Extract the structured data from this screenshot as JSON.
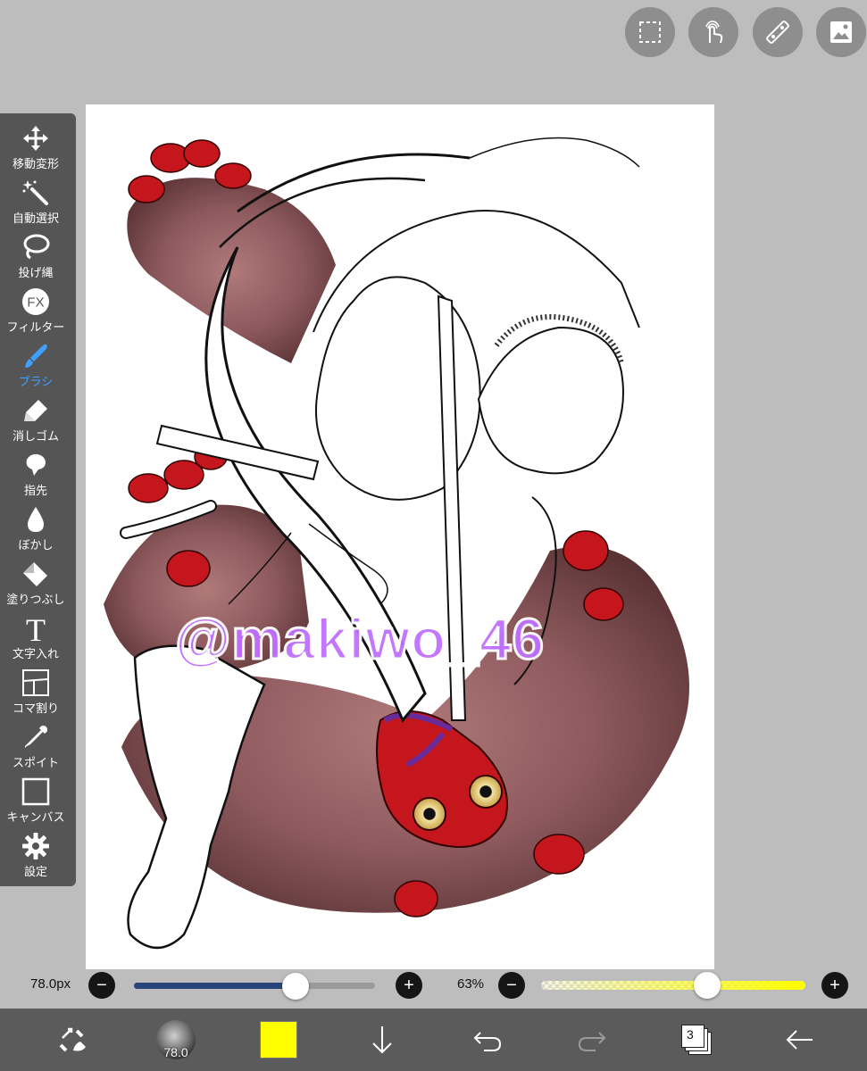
{
  "top_actions": [
    {
      "name": "selection-icon"
    },
    {
      "name": "gesture-icon"
    },
    {
      "name": "ruler-icon"
    },
    {
      "name": "image-icon"
    }
  ],
  "toolbar": {
    "items": [
      {
        "label": "移動変形",
        "icon": "move-transform-icon"
      },
      {
        "label": "自動選択",
        "icon": "magic-wand-icon"
      },
      {
        "label": "投げ縄",
        "icon": "lasso-icon"
      },
      {
        "label": "フィルター",
        "icon": "fx-icon",
        "icon_text": "FX"
      },
      {
        "label": "ブラシ",
        "icon": "brush-icon",
        "active": true
      },
      {
        "label": "消しゴム",
        "icon": "eraser-icon"
      },
      {
        "label": "指先",
        "icon": "finger-icon"
      },
      {
        "label": "ぼかし",
        "icon": "blur-drop-icon"
      },
      {
        "label": "塗りつぶし",
        "icon": "fill-bucket-icon"
      },
      {
        "label": "文字入れ",
        "icon": "text-icon",
        "icon_text": "T"
      },
      {
        "label": "コマ割り",
        "icon": "panel-split-icon"
      },
      {
        "label": "スポイト",
        "icon": "eyedropper-icon"
      },
      {
        "label": "キャンバス",
        "icon": "canvas-icon"
      },
      {
        "label": "設定",
        "icon": "gear-icon"
      }
    ],
    "active_color": "#3ea0ff"
  },
  "canvas": {
    "watermark": "@makiwo_46",
    "background": "#ffffff"
  },
  "brush_size": {
    "label": "78.0px",
    "value_fraction": 0.67,
    "minus": "−",
    "plus": "+"
  },
  "opacity": {
    "label": "63%",
    "value_fraction": 0.63,
    "minus": "−",
    "plus": "+"
  },
  "bottom_bar": {
    "brush_preview_value": "78.0",
    "current_color": "#ffff00",
    "layer_count": "3"
  },
  "colors": {
    "toolbar_bg": "#555555",
    "bottom_bar_bg": "#5b5b5b",
    "workspace_bg": "#bdbdbd",
    "size_slider_fill": "#27457a"
  }
}
